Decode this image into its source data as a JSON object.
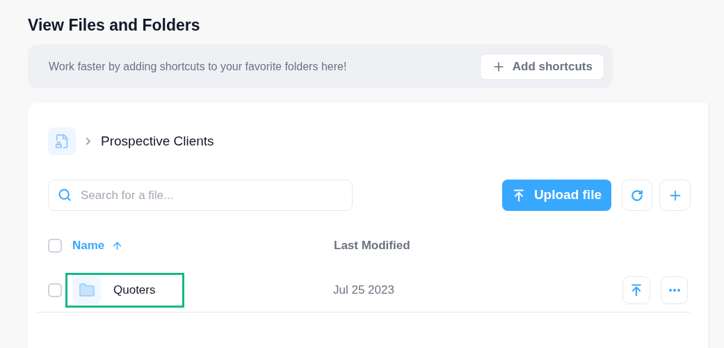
{
  "page_title": "View Files and Folders",
  "shortcuts": {
    "message": "Work faster by adding shortcuts to your favorite folders here!",
    "button": "Add shortcuts"
  },
  "breadcrumb": {
    "current": "Prospective Clients"
  },
  "search": {
    "placeholder": "Search for a file..."
  },
  "toolbar": {
    "upload_button": "Upload file"
  },
  "table": {
    "select_all_checked": false,
    "columns": [
      {
        "label": "Name",
        "sorted": true
      },
      {
        "label": "Last Modified",
        "sorted": false
      }
    ],
    "rows": [
      {
        "name": "Quoters",
        "modified": "Jul 25 2023",
        "checked": false,
        "highlighted": true
      }
    ]
  }
}
